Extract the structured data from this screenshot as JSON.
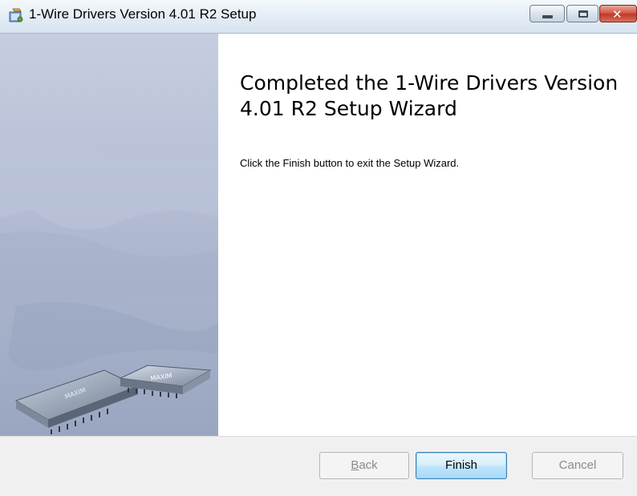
{
  "window": {
    "title": "1-Wire Drivers Version 4.01 R2 Setup",
    "icon": "setup-installer-icon",
    "controls": {
      "minimize": "minimize-icon",
      "maximize": "maximize-icon",
      "close": "close-icon",
      "close_glyph": "✕"
    }
  },
  "banner": {
    "brand_chip_1": "MAXIM",
    "brand_chip_2": "MAXIM"
  },
  "main": {
    "heading": "Completed the 1-Wire Drivers Version 4.01 R2 Setup Wizard",
    "instruction": "Click the Finish button to exit the Setup Wizard."
  },
  "buttons": {
    "back_mnemonic": "B",
    "back_rest": "ack",
    "finish": "Finish",
    "cancel": "Cancel"
  },
  "colors": {
    "finish_border": "#3c7fb1",
    "close_red": "#c0392b"
  }
}
